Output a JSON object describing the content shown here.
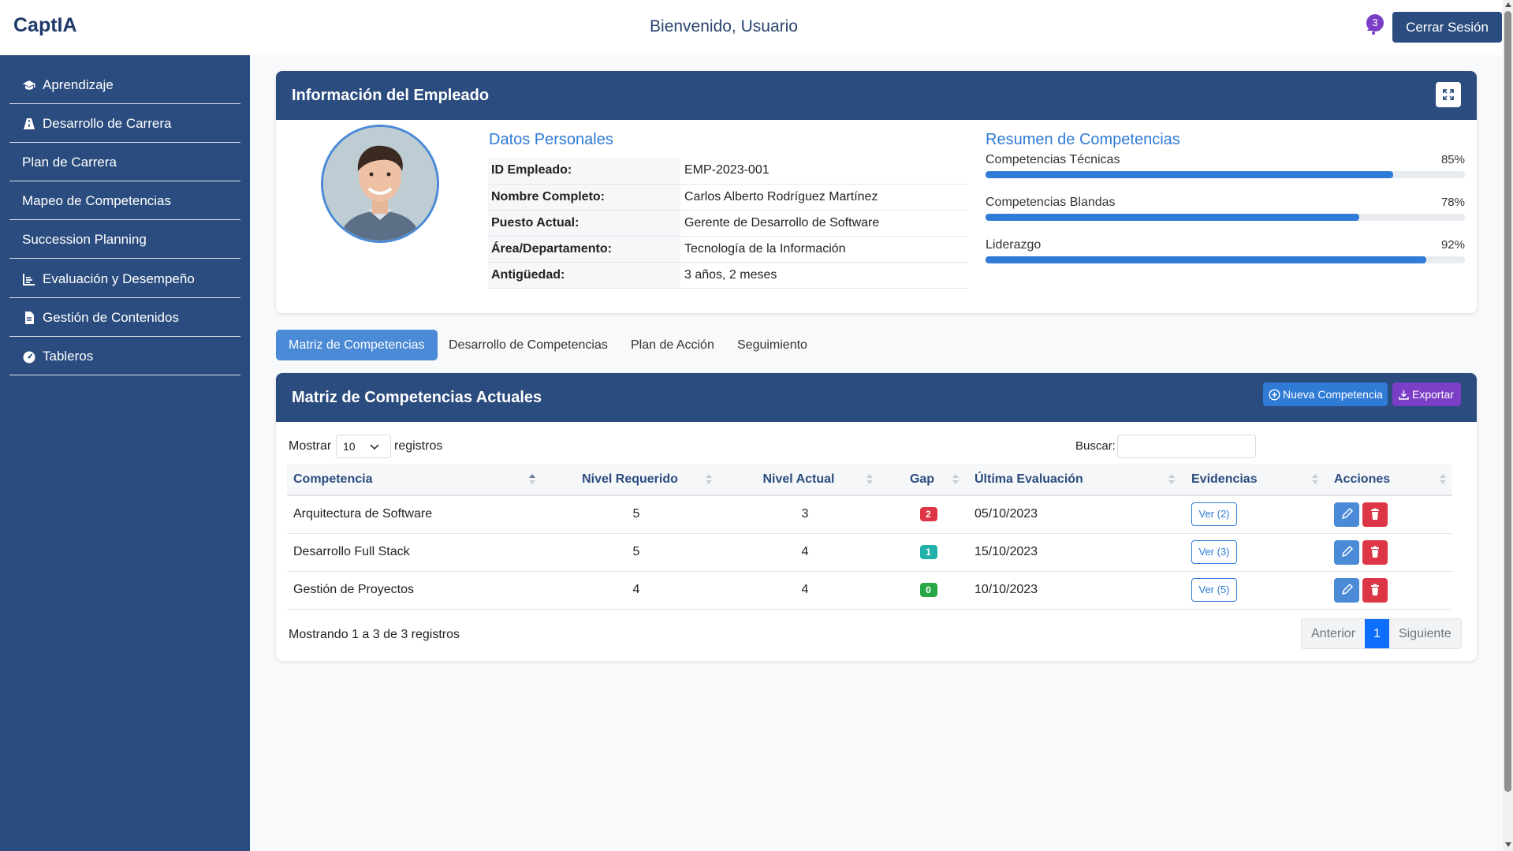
{
  "header": {
    "brand": "CaptIA",
    "welcome": "Bienvenido, Usuario",
    "notification_count": "3",
    "logout_label": "Cerrar Sesión"
  },
  "sidebar": {
    "items": [
      {
        "label": "Aprendizaje",
        "icon": "graduation-cap-icon"
      },
      {
        "label": "Desarrollo de Carrera",
        "icon": "road-icon"
      },
      {
        "label": "Plan de Carrera",
        "icon": ""
      },
      {
        "label": "Mapeo de Competencias",
        "icon": ""
      },
      {
        "label": "Succession Planning",
        "icon": ""
      },
      {
        "label": "Evaluación y Desempeño",
        "icon": "chart-line-icon"
      },
      {
        "label": "Gestión de Contenidos",
        "icon": "file-icon"
      },
      {
        "label": "Tableros",
        "icon": "gauge-icon"
      }
    ]
  },
  "employee": {
    "title": "Información del Empleado",
    "personal_title": "Datos Personales",
    "fields": [
      {
        "label": "ID Empleado:",
        "value": "EMP-2023-001"
      },
      {
        "label": "Nombre Completo:",
        "value": "Carlos Alberto Rodríguez Martínez"
      },
      {
        "label": "Puesto Actual:",
        "value": "Gerente de Desarrollo de Software"
      },
      {
        "label": "Área/Departamento:",
        "value": "Tecnología de la Información"
      },
      {
        "label": "Antigüedad:",
        "value": "3 años, 2 meses"
      }
    ],
    "summary_title": "Resumen de Competencias",
    "competencies": [
      {
        "name": "Competencias Técnicas",
        "percent_label": "85%",
        "percent": 85
      },
      {
        "name": "Competencias Blandas",
        "percent_label": "78%",
        "percent": 78
      },
      {
        "name": "Liderazgo",
        "percent_label": "92%",
        "percent": 92
      }
    ]
  },
  "tabs": [
    {
      "label": "Matriz de Competencias",
      "active": true
    },
    {
      "label": "Desarrollo de Competencias",
      "active": false
    },
    {
      "label": "Plan de Acción",
      "active": false
    },
    {
      "label": "Seguimiento",
      "active": false
    }
  ],
  "matrix": {
    "title": "Matriz de Competencias Actuales",
    "new_button": "Nueva Competencia",
    "export_button": "Exportar",
    "show_label": "Mostrar",
    "show_value": "10",
    "records_label": "registros",
    "search_label": "Buscar:",
    "columns": [
      "Competencia",
      "Nivel Requerido",
      "Nivel Actual",
      "Gap",
      "Última Evaluación",
      "Evidencias",
      "Acciones"
    ],
    "rows": [
      {
        "competencia": "Arquitectura de Software",
        "requerido": "5",
        "actual": "3",
        "gap": "2",
        "fecha": "05/10/2023",
        "evidencias": "Ver (2)"
      },
      {
        "competencia": "Desarrollo Full Stack",
        "requerido": "5",
        "actual": "4",
        "gap": "1",
        "fecha": "15/10/2023",
        "evidencias": "Ver (3)"
      },
      {
        "competencia": "Gestión de Proyectos",
        "requerido": "4",
        "actual": "4",
        "gap": "0",
        "fecha": "10/10/2023",
        "evidencias": "Ver (5)"
      }
    ],
    "footer_info": "Mostrando 1 a 3 de 3 registros",
    "pager": {
      "prev": "Anterior",
      "current": "1",
      "next": "Siguiente"
    }
  },
  "colors": {
    "primary": "#2b4c7e",
    "accent": "#2f7bd6",
    "gap_high": "#dc3545",
    "gap_mid": "#20b2aa",
    "gap_zero": "#28a745",
    "export": "#7b3fc7"
  }
}
